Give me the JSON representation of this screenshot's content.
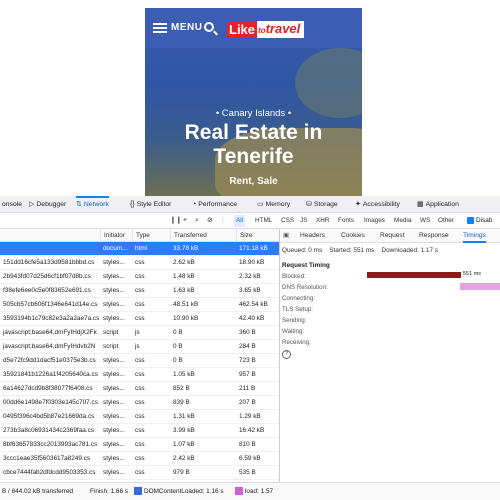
{
  "site": {
    "menu_label": "MENU",
    "logo_part1": "Like",
    "logo_part2_small": "to",
    "logo_part3": "travel",
    "hero_subtitle": "• Canary Islands •",
    "hero_title_line1": "Real Estate in",
    "hero_title_line2": "Tenerife",
    "hero_tagline": "Rent, Sale"
  },
  "devtools": {
    "tabs": [
      {
        "label": "onsole",
        "icon": ""
      },
      {
        "label": "Debugger",
        "icon": "▷"
      },
      {
        "label": "Network",
        "icon": "⇅"
      },
      {
        "label": "Style Editor",
        "icon": "{}"
      },
      {
        "label": "Performance",
        "icon": "◔"
      },
      {
        "label": "Memory",
        "icon": "▭"
      },
      {
        "label": "Storage",
        "icon": "⛁"
      },
      {
        "label": "Accessibility",
        "icon": "✦"
      },
      {
        "label": "Application",
        "icon": "▦"
      }
    ],
    "active_tab": "Network",
    "filters": [
      "All",
      "HTML",
      "CSS",
      "JS",
      "XHR",
      "Fonts",
      "Images",
      "Media",
      "WS",
      "Other"
    ],
    "active_filter": "All",
    "disable_label": "Disab",
    "columns": [
      "Initiator",
      "Type",
      "Transferred",
      "Size"
    ],
    "rows": [
      {
        "file": "",
        "initiator": "docum...",
        "type": "html",
        "transferred": "33.78 kB",
        "size": "171.18 kB"
      },
      {
        "file": "151dd16cfe5a133d9581bbbd.cs",
        "initiator": "styles...",
        "type": "css",
        "transferred": "2.62 kB",
        "size": "18.90 kB"
      },
      {
        "file": "2b943fd07d25d6cf1bf07d8b.cs",
        "initiator": "styles...",
        "type": "css",
        "transferred": "1.48 kB",
        "size": "2.32 kB"
      },
      {
        "file": "f38efe6ee0c5e0f83652e691.cs",
        "initiator": "styles...",
        "type": "css",
        "transferred": "1.63 kB",
        "size": "3.65 kB"
      },
      {
        "file": "505cb57cb606f1346e641d14e.cs",
        "initiator": "styles...",
        "type": "css",
        "transferred": "48.51 kB",
        "size": "462.54 kB"
      },
      {
        "file": "3593194b1c79c82e3a2a2ae7a.cs",
        "initiator": "styles...",
        "type": "css",
        "transferred": "10.90 kB",
        "size": "42.40 kB"
      },
      {
        "file": "javascript;base64,dmFyIHdjX2Fk",
        "initiator": "script",
        "type": "js",
        "transferred": "0 B",
        "size": "360 B"
      },
      {
        "file": "javascript;base64,dmFyIHdvb2N",
        "initiator": "script",
        "type": "js",
        "transferred": "0 B",
        "size": "284 B"
      },
      {
        "file": "d5e72fc9dd1dacf51e0375e3b.cs",
        "initiator": "styles...",
        "type": "css",
        "transferred": "0 B",
        "size": "723 B"
      },
      {
        "file": "35921841b1226a1f4205640ca.cs",
        "initiator": "styles...",
        "type": "css",
        "transferred": "1.05 kB",
        "size": "957 B"
      },
      {
        "file": "6a14627dcd9b8f38077f6408.cs",
        "initiator": "styles...",
        "type": "css",
        "transferred": "852 B",
        "size": "211 B"
      },
      {
        "file": "00dd6e1498e7f0303e145c707.cs",
        "initiator": "styles...",
        "type": "css",
        "transferred": "839 B",
        "size": "207 B"
      },
      {
        "file": "0495f396c4bd5b87e21669da.cs",
        "initiator": "styles...",
        "type": "css",
        "transferred": "1.31 kB",
        "size": "1.29 kB"
      },
      {
        "file": "273b3a8c06931434c2369faa.cs",
        "initiator": "styles...",
        "type": "css",
        "transferred": "3.99 kB",
        "size": "16.42 kB"
      },
      {
        "file": "8bf63657833cc2013993ac781.cs",
        "initiator": "styles...",
        "type": "css",
        "transferred": "1.07 kB",
        "size": "810 B"
      },
      {
        "file": "3ccc1eae35f5603617a8249.cs",
        "initiator": "styles...",
        "type": "css",
        "transferred": "2.42 kB",
        "size": "6.59 kB"
      },
      {
        "file": "cbce7444fab2dfdcdd9503353.cs",
        "initiator": "styles...",
        "type": "css",
        "transferred": "979 B",
        "size": "535 B"
      }
    ],
    "detail_tabs": [
      "Headers",
      "Cookies",
      "Request",
      "Response",
      "Timings"
    ],
    "active_detail_tab": "Timings",
    "queued": "Queued: 0 ms",
    "started": "Started: 551 ms",
    "downloaded": "Downloaded: 1.17 s",
    "request_timing_title": "Request Timing",
    "timing_labels": [
      "Blocked:",
      "DNS Resolution:",
      "Connecting:",
      "TLS Setup:",
      "Sending:",
      "Waiting:",
      "Receiving:"
    ],
    "blocked_value": "551 ms",
    "status": {
      "transferred": "B / 644.02 kB transferred",
      "finish": "Finish: 1.66 s",
      "dom_content_loaded": "DOMContentLoaded: 1.16 s",
      "load": "load: 1.57"
    },
    "colors": {
      "accent": "#0a84ff",
      "selected_row": "#2f7bff",
      "blocked_bar": "#8a1c1c",
      "dns_bar": "#e2a3e4",
      "dcl": "#3b6ad6",
      "load": "#d05fd6"
    }
  }
}
